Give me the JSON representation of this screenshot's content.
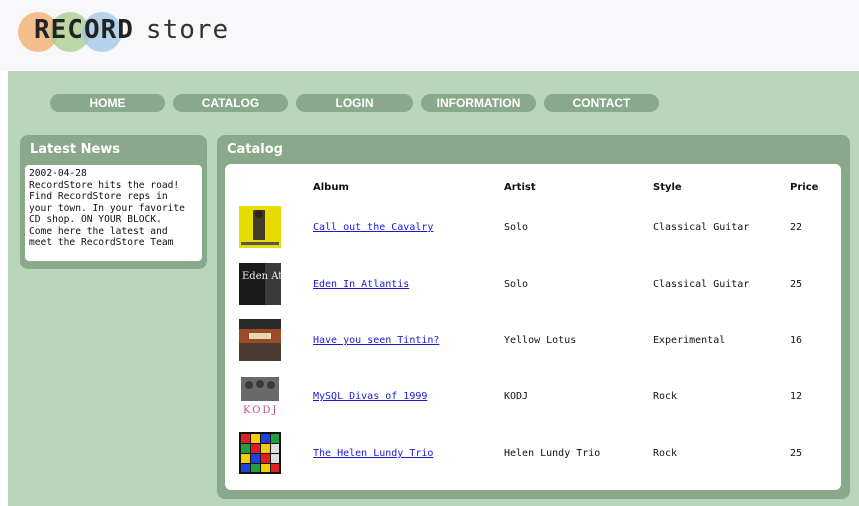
{
  "logo": {
    "part1": "RECORD",
    "part2": "store"
  },
  "nav": [
    "HOME",
    "CATALOG",
    "LOGIN",
    "INFORMATION",
    "CONTACT"
  ],
  "news": {
    "title": "Latest News",
    "lines": [
      "2002-04-28",
      "RecordStore hits the road!",
      "Find RecordStore reps in",
      "your town. In your favorite",
      "CD shop. ON YOUR BLOCK.",
      "Come here the latest and",
      "meet the RecordStore Team"
    ]
  },
  "catalog": {
    "title": "Catalog",
    "headers": {
      "album": "Album",
      "artist": "Artist",
      "style": "Style",
      "price": "Price"
    },
    "rows": [
      {
        "album": "Call out the Cavalry",
        "artist": "Solo",
        "style": "Classical Guitar",
        "price": "22"
      },
      {
        "album": "Eden In Atlantis",
        "artist": "Solo",
        "style": "Classical Guitar",
        "price": "25"
      },
      {
        "album": "Have you seen Tintin?",
        "artist": "Yellow Lotus",
        "style": "Experimental",
        "price": "16"
      },
      {
        "album": "MySQL Divas of 1999",
        "artist": "KODJ",
        "style": "Rock",
        "price": "12"
      },
      {
        "album": "The Helen Lundy Trio",
        "artist": "Helen Lundy Trio",
        "style": "Rock",
        "price": "25"
      }
    ]
  },
  "cover_text": {
    "eden": "Eden Atlantis",
    "kodj": "KODJ"
  },
  "colors": {
    "green_dark": "#8aa88a",
    "green_light": "#b9d6b9",
    "link": "#1a1ad8"
  }
}
